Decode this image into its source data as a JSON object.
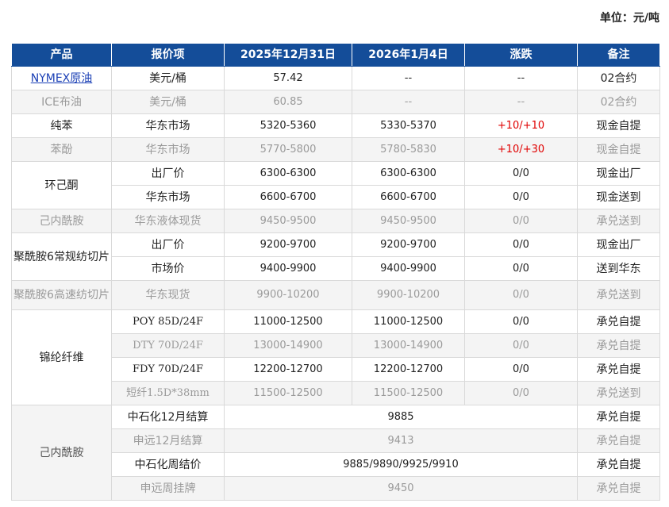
{
  "unit_label": "单位：元/吨",
  "headers": [
    "产品",
    "报价项",
    "2025年12月31日",
    "2026年1月4日",
    "涨跌",
    "备注"
  ],
  "rows": {
    "nymex": {
      "product": "NYMEX原油",
      "item": "美元/桶",
      "d1": "57.42",
      "d2": "--",
      "chg": "--",
      "note": "02合约"
    },
    "ice": {
      "product": "ICE布油",
      "item": "美元/桶",
      "d1": "60.85",
      "d2": "--",
      "chg": "--",
      "note": "02合约"
    },
    "benzene": {
      "product": "纯苯",
      "item": "华东市场",
      "d1": "5320-5360",
      "d2": "5330-5370",
      "chg": "+10/+10",
      "note": "现金自提"
    },
    "phenol": {
      "product": "苯酚",
      "item": "华东市场",
      "d1": "5770-5800",
      "d2": "5780-5830",
      "chg": "+10/+30",
      "note": "现金自提"
    },
    "cyclohexanone_a": {
      "product": "环己酮",
      "item": "出厂价",
      "d1": "6300-6300",
      "d2": "6300-6300",
      "chg": "0/0",
      "note": "现金出厂"
    },
    "cyclohexanone_b": {
      "item": "华东市场",
      "d1": "6600-6700",
      "d2": "6600-6700",
      "chg": "0/0",
      "note": "现金送到"
    },
    "caprolactam": {
      "product": "己内酰胺",
      "item": "华东液体现货",
      "d1": "9450-9500",
      "d2": "9450-9500",
      "chg": "0/0",
      "note": "承兑送到"
    },
    "pa6_regular_a": {
      "product": "聚酰胺6常规纺切片",
      "item": "出厂价",
      "d1": "9200-9700",
      "d2": "9200-9700",
      "chg": "0/0",
      "note": "现金出厂"
    },
    "pa6_regular_b": {
      "item": "市场价",
      "d1": "9400-9900",
      "d2": "9400-9900",
      "chg": "0/0",
      "note": "送到华东"
    },
    "pa6_highspeed": {
      "product": "聚酰胺6高速纺切片",
      "item": "华东现货",
      "d1": "9900-10200",
      "d2": "9900-10200",
      "chg": "0/0",
      "note": "承兑送到"
    },
    "nylon_poy": {
      "product": "锦纶纤维",
      "item": "POY 85D/24F",
      "d1": "11000-12500",
      "d2": "11000-12500",
      "chg": "0/0",
      "note": "承兑自提"
    },
    "nylon_dty": {
      "item": "DTY 70D/24F",
      "d1": "13000-14900",
      "d2": "13000-14900",
      "chg": "0/0",
      "note": "承兑自提"
    },
    "nylon_fdy": {
      "item": "FDY 70D/24F",
      "d1": "12200-12700",
      "d2": "12200-12700",
      "chg": "0/0",
      "note": "承兑自提"
    },
    "nylon_staple": {
      "item": "短纤1.5D*38mm",
      "d1": "11500-12500",
      "d2": "11500-12500",
      "chg": "0/0",
      "note": "承兑送到"
    },
    "cpl_sinopec_month": {
      "product": "己内酰胺",
      "item": "中石化12月结算",
      "value": "9885",
      "note": "承兑自提"
    },
    "cpl_shenyuan_month": {
      "item": "申远12月结算",
      "value": "9413",
      "note": "承兑自提"
    },
    "cpl_sinopec_week": {
      "item": "中石化周结价",
      "value": "9885/9890/9925/9910",
      "note": "承兑自提"
    },
    "cpl_shenyuan_week": {
      "item": "申远周挂牌",
      "value": "9450",
      "note": "承兑自提"
    }
  },
  "colors": {
    "header_bg": "#144d99",
    "rise": "#e00000",
    "muted_text": "#9a9a9a",
    "link": "#1a3fb5"
  }
}
